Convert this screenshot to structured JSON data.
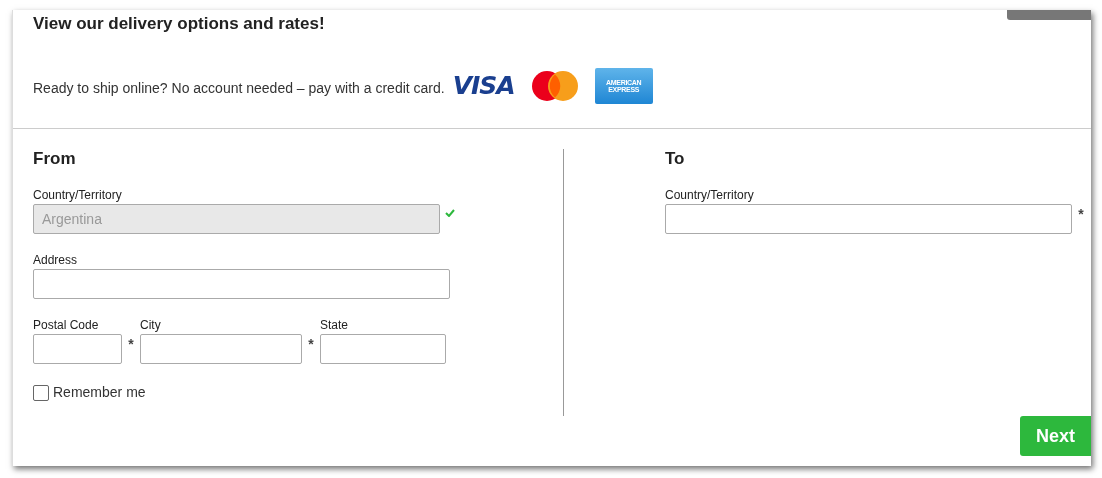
{
  "heading": "View our delivery options and rates!",
  "payment": {
    "text": "Ready to ship online? No account needed – pay with a credit card.",
    "cards": [
      {
        "kind": "visa",
        "label": "VISA"
      },
      {
        "kind": "mastercard"
      },
      {
        "kind": "amex",
        "label": "AMERICAN EXPRESS"
      }
    ]
  },
  "from": {
    "title": "From",
    "rows": [
      [
        {
          "label": "Country/Territory",
          "value": "Argentina",
          "disabled": true,
          "valid": true
        }
      ],
      [
        {
          "label": "Address",
          "disabled": false,
          "valid": false
        }
      ],
      [
        {
          "label": "Postal Code",
          "disabled": false,
          "valid": false,
          "required_mark": "*"
        },
        {
          "label": "City",
          "disabled": false,
          "valid": false,
          "required_mark": "*"
        },
        {
          "label": "State",
          "disabled": false,
          "valid": false
        }
      ]
    ],
    "remember": {
      "label": "Remember me",
      "checked": false
    }
  },
  "to": {
    "title": "To",
    "rows": [
      [
        {
          "label": "Country/Territory",
          "disabled": false,
          "valid": false,
          "required_mark": "*"
        }
      ]
    ]
  },
  "next_button": "Next"
}
